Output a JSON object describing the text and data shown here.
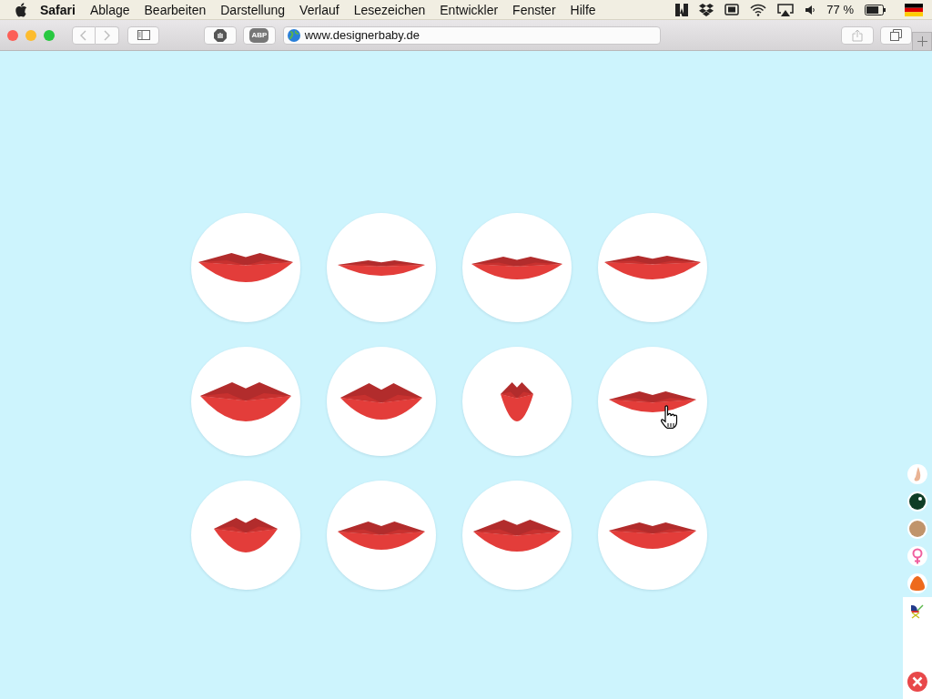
{
  "menubar": {
    "app": "Safari",
    "menus": [
      "Ablage",
      "Bearbeiten",
      "Darstellung",
      "Verlauf",
      "Lesezeichen",
      "Entwickler",
      "Fenster",
      "Hilfe"
    ],
    "battery_percent": "77 %",
    "battery": {
      "level": 0.77
    }
  },
  "toolbar": {
    "adblock_label": "ABP",
    "address": "www.designerbaby.de"
  },
  "lip_options": [
    {
      "kind": "full"
    },
    {
      "kind": "thin"
    },
    {
      "kind": "medium"
    },
    {
      "kind": "wide"
    },
    {
      "kind": "plump"
    },
    {
      "kind": "heart"
    },
    {
      "kind": "pout"
    },
    {
      "kind": "slim"
    },
    {
      "kind": "round"
    },
    {
      "kind": "broad"
    },
    {
      "kind": "bow"
    },
    {
      "kind": "flat"
    }
  ],
  "sidebar": {
    "items": [
      {
        "kind": "nose",
        "selected": false
      },
      {
        "kind": "eye",
        "selected": false
      },
      {
        "kind": "skin",
        "selected": false
      },
      {
        "kind": "gender",
        "selected": false
      },
      {
        "kind": "hair",
        "selected": false
      },
      {
        "kind": "pram",
        "selected": true
      }
    ]
  }
}
